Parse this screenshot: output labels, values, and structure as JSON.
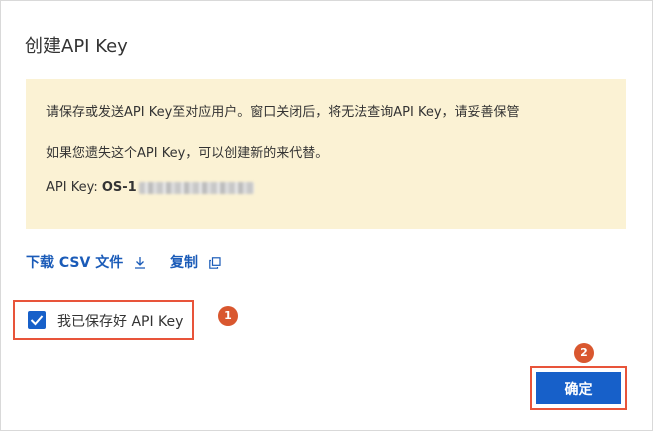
{
  "dialog": {
    "title": "创建API Key"
  },
  "notice": {
    "line1": "请保存或发送API Key至对应用户。窗口关闭后，将无法查询API Key，请妥善保管",
    "line2": "如果您遗失这个API Key，可以创建新的来代替。",
    "api_key_label": "API Key: ",
    "api_key_value": "OS-1",
    "background_color": "#fbf2d4"
  },
  "actions": {
    "download_label": "下载 CSV 文件",
    "download_icon": "download-icon",
    "copy_label": "复制",
    "copy_icon": "copy-icon"
  },
  "confirm_checkbox": {
    "label": "我已保存好 API Key",
    "checked": true
  },
  "annotations": {
    "step1": "1",
    "step2": "2",
    "highlight_color": "#e8543a",
    "badge_color": "#d9572f"
  },
  "footer": {
    "confirm_label": "确定",
    "accent_color": "#1760c9"
  }
}
